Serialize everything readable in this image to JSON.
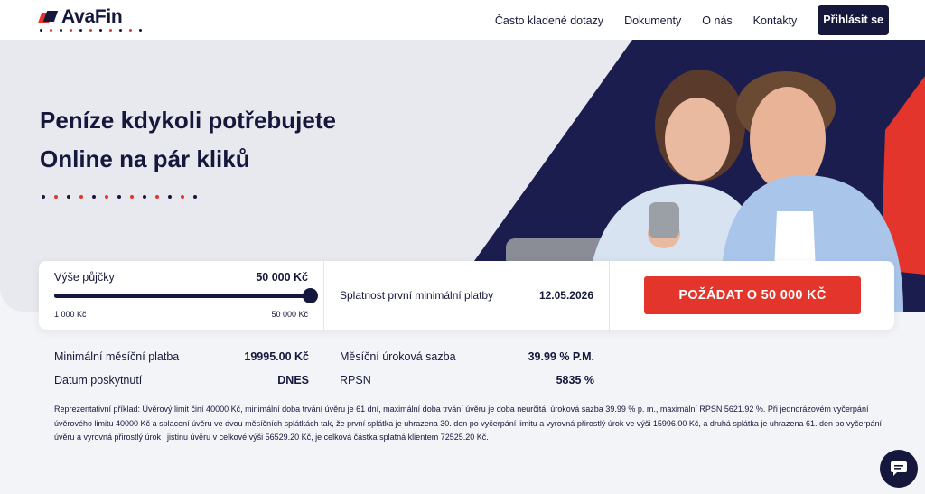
{
  "header": {
    "logo_text": "AvaFin",
    "nav": [
      "Často kladené dotazy",
      "Dokumenty",
      "O nás",
      "Kontakty"
    ],
    "login_label": "Přihlásit se"
  },
  "hero": {
    "title_line1": "Peníze kdykoli potřebujete",
    "title_line2": "Online na pár kliků"
  },
  "calculator": {
    "amount_label": "Výše půjčky",
    "amount_value": "50 000 Kč",
    "slider_min_label": "1 000 Kč",
    "slider_max_label": "50 000 Kč",
    "slider_fraction": 1.0,
    "repayment_label": "Splatnost první minimální platby",
    "repayment_date": "12.05.2026",
    "cta_label": "POŽÁDAT O 50 000 KČ"
  },
  "summary": {
    "min_payment_label": "Minimální měsíční platba",
    "min_payment_value": "19995.00 Kč",
    "provision_date_label": "Datum poskytnutí",
    "provision_date_value": "DNES",
    "monthly_rate_label": "Měsíční úroková sazba",
    "monthly_rate_value": "39.99 % P.M.",
    "rpsn_label": "RPSN",
    "rpsn_value": "5835 %"
  },
  "disclaimer": "Reprezentativní příklad: Úvěrový limit činí 40000 Kč, minimální doba trvání úvěru je 61 dní, maximální doba trvání úvěru je doba neurčitá, úroková sazba 39.99 % p. m., maximální RPSN 5621.92 %. Při jednorázovém vyčerpání úvěrového limitu 40000 Kč a splacení úvěru ve dvou měsíčních splátkách tak, že první splátka je uhrazena 30. den po vyčerpání limitu a vyrovná přirostlý úrok ve výši 15996.00 Kč, a druhá splátka je uhrazena 61. den po vyčerpání úvěru a vyrovná přirostlý úrok i jistinu úvěru v celkové výši 56529.20 Kč, je celková částka splatná klientem 72525.20 Kč.",
  "colors": {
    "navy": "#15173d",
    "red": "#e3352b",
    "background": "#f3f4f7"
  },
  "icons": {
    "chat": "chat-bubble-icon"
  }
}
